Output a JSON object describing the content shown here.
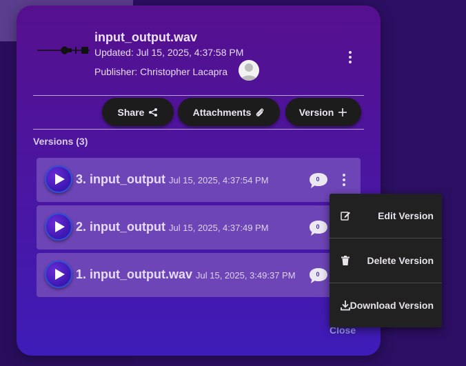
{
  "file": {
    "title": "input_output.wav",
    "updated": "Updated: Jul 15, 2025, 4:37:58 PM",
    "publisher": "Publisher: Christopher Lacapra"
  },
  "actions": {
    "share": "Share",
    "attachments": "Attachments",
    "version": "Version"
  },
  "versions_label": "Versions (3)",
  "versions": [
    {
      "name": "3. input_output",
      "date": "Jul 15, 2025, 4:37:54 PM",
      "comments": "0"
    },
    {
      "name": "2. input_output",
      "date": "Jul 15, 2025, 4:37:49 PM",
      "comments": "0"
    },
    {
      "name": "1. input_output.wav",
      "date": "Jul 15, 2025, 3:49:37 PM",
      "comments": "0"
    }
  ],
  "menu": {
    "edit": "Edit Version",
    "delete": "Delete Version",
    "download": "Download Version"
  },
  "close_label": "Close",
  "icons": {
    "share": "share-icon",
    "attachments": "paperclip-icon",
    "version": "plus-icon",
    "play": "play-icon",
    "comment": "comment-icon",
    "edit": "edit-icon",
    "delete": "trash-icon",
    "download": "download-icon"
  },
  "colors": {
    "card_top": "#55108e",
    "card_bottom": "#3e1cb8",
    "row": "#6e45b7",
    "pill": "#1c1c1c",
    "menu": "#212121",
    "close": "#9fa2f2"
  }
}
